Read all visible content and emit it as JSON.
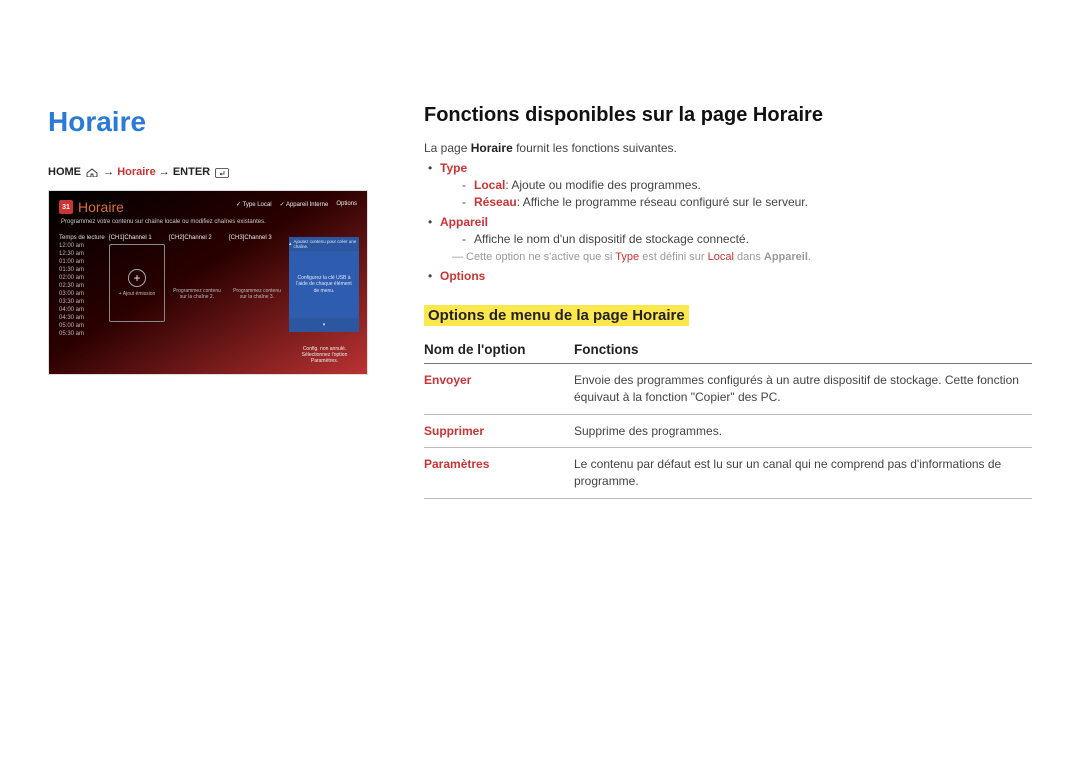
{
  "left": {
    "title": "Horaire",
    "breadcrumb": {
      "home": "HOME",
      "arrow1": " → ",
      "mid": "Horaire",
      "arrow2": " → ",
      "enter": "ENTER"
    }
  },
  "thumb": {
    "cal_day": "31",
    "title": "Horaire",
    "menu_type_label": "Type",
    "menu_type_value": "Local",
    "menu_device_label": "Appareil",
    "menu_device_value": "Interne",
    "menu_options": "Options",
    "subtitle": "Programmez votre contenu sur chaîne locale ou modifiez chaînes existantes.",
    "time_header": "Temps de lecture",
    "times": [
      "12:00 am",
      "12:30 am",
      "01:00 am",
      "01:30 am",
      "02:00 am",
      "02:30 am",
      "03:00 am",
      "03:30 am",
      "04:00 am",
      "04:30 am",
      "05:00 am",
      "05:30 am"
    ],
    "ch1": "[CH1]Channel 1",
    "ch2": "[CH2]Channel 2",
    "ch3": "[CH3]Channel 3",
    "ch1_add": "+ Ajout émission",
    "ch2_text": "Programmez contenu sur la chaîne 2.",
    "ch3_text": "Programmez contenu sur la chaîne 3.",
    "popup_top_hint": "Ajoutez contenu pour créer une chaîne.",
    "popup_body": "Configurez la clé USB à l'aide de chaque élément de menu.",
    "popup_caption": "Config. non annulé. Sélectionnez l'option Paramètres."
  },
  "right": {
    "h2": "Fonctions disponibles sur la page Horaire",
    "intro_pre": "La page ",
    "intro_bold": "Horaire",
    "intro_post": " fournit les fonctions suivantes.",
    "type_label": "Type",
    "type_local_b": "Local",
    "type_local_t": ": Ajoute ou modifie des programmes.",
    "type_reseau_b": "Réseau",
    "type_reseau_t": ": Affiche le programme réseau configuré sur le serveur.",
    "appareil_label": "Appareil",
    "appareil_line": "Affiche le nom d'un dispositif de stockage connecté.",
    "note_a": "Cette option ne s'active que si ",
    "note_b": "Type",
    "note_c": " est défini sur ",
    "note_d": "Local",
    "note_e": " dans ",
    "note_f": "Appareil",
    "note_g": ".",
    "options_label": "Options",
    "h3": "Options de menu de la page Horaire",
    "th1": "Nom de l'option",
    "th2": "Fonctions",
    "rows": [
      {
        "name": "Envoyer",
        "desc": "Envoie des programmes configurés à un autre dispositif de stockage. Cette fonction équivaut à la fonction \"Copier\" des PC."
      },
      {
        "name": "Supprimer",
        "desc": "Supprime des programmes."
      },
      {
        "name": "Paramètres",
        "desc": "Le contenu par défaut est lu sur un canal qui ne comprend pas d'informations de programme."
      }
    ]
  }
}
